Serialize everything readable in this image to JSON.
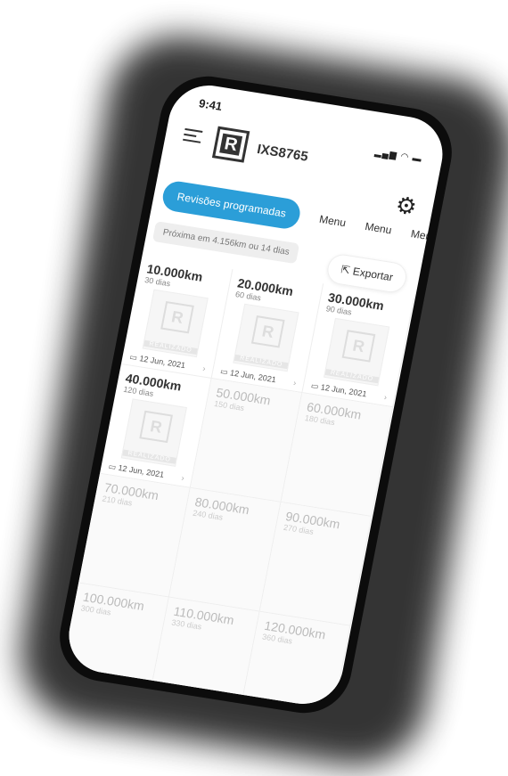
{
  "status": {
    "time": "9:41",
    "icons": "signal wifi battery"
  },
  "header": {
    "logo_letter": "R",
    "plate": "IXS8765"
  },
  "tabs": {
    "active": "Revisões programadas",
    "others": [
      "Menu",
      "Menu",
      "Menu"
    ]
  },
  "next": "Próxima em 4.156km ou 14 dias",
  "export_label": "Exportar",
  "stamp_label": "REALIZADO",
  "cards": [
    {
      "km": "10.000km",
      "days": "30 dias",
      "date": "12 Jun, 2021",
      "done": true
    },
    {
      "km": "20.000km",
      "days": "60 dias",
      "date": "12 Jun, 2021",
      "done": true
    },
    {
      "km": "30.000km",
      "days": "90 dias",
      "date": "12 Jun, 2021",
      "done": true
    },
    {
      "km": "40.000km",
      "days": "120 dias",
      "date": "12 Jun, 2021",
      "done": true
    },
    {
      "km": "50.000km",
      "days": "150 dias",
      "done": false
    },
    {
      "km": "60.000km",
      "days": "180 dias",
      "done": false
    },
    {
      "km": "70.000km",
      "days": "210 dias",
      "done": false
    },
    {
      "km": "80.000km",
      "days": "240 dias",
      "done": false
    },
    {
      "km": "90.000km",
      "days": "270 dias",
      "done": false
    },
    {
      "km": "100.000km",
      "days": "300 dias",
      "done": false
    },
    {
      "km": "110.000km",
      "days": "330 dias",
      "done": false
    },
    {
      "km": "120.000km",
      "days": "360 dias",
      "done": false
    }
  ],
  "colors": {
    "accent": "#2b9ed8"
  }
}
